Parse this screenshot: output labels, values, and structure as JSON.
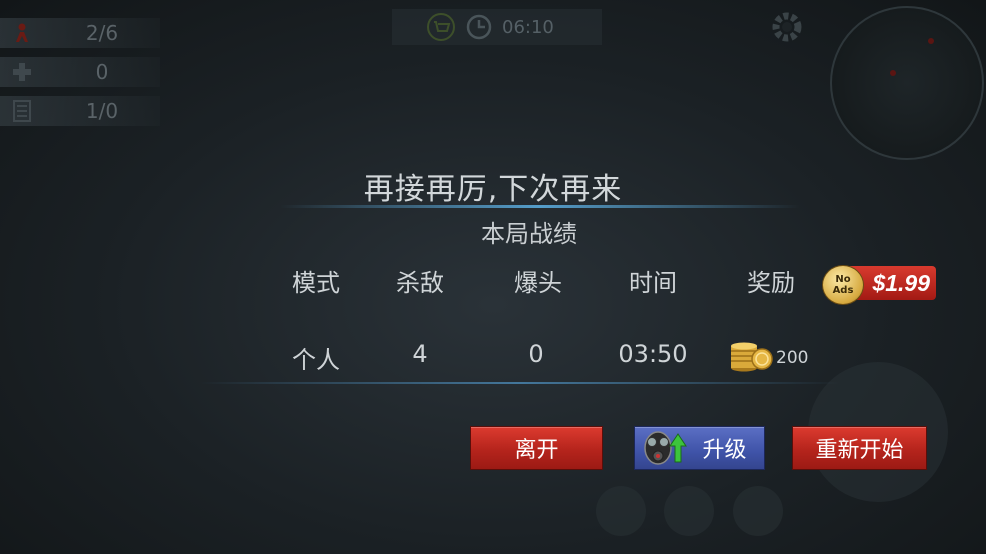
{
  "hud": {
    "players": "2/6",
    "medkits": "0",
    "ammo": "1/0",
    "match_time": "06:10"
  },
  "result": {
    "title": "再接再厉,下次再来",
    "subtitle": "本局战绩",
    "headers": {
      "mode": "模式",
      "kills": "杀敌",
      "headshots": "爆头",
      "time": "时间",
      "reward": "奖励"
    },
    "values": {
      "mode": "个人",
      "kills": "4",
      "headshots": "0",
      "time": "03:50",
      "reward": "200"
    }
  },
  "promo": {
    "no_ads_line1": "No",
    "no_ads_line2": "Ads",
    "price": "$1.99"
  },
  "buttons": {
    "leave": "离开",
    "upgrade": "升级",
    "restart": "重新开始"
  },
  "colors": {
    "accent_red": "#c62b21",
    "accent_blue": "#4659b0",
    "divider_blue": "#5aaadc"
  }
}
